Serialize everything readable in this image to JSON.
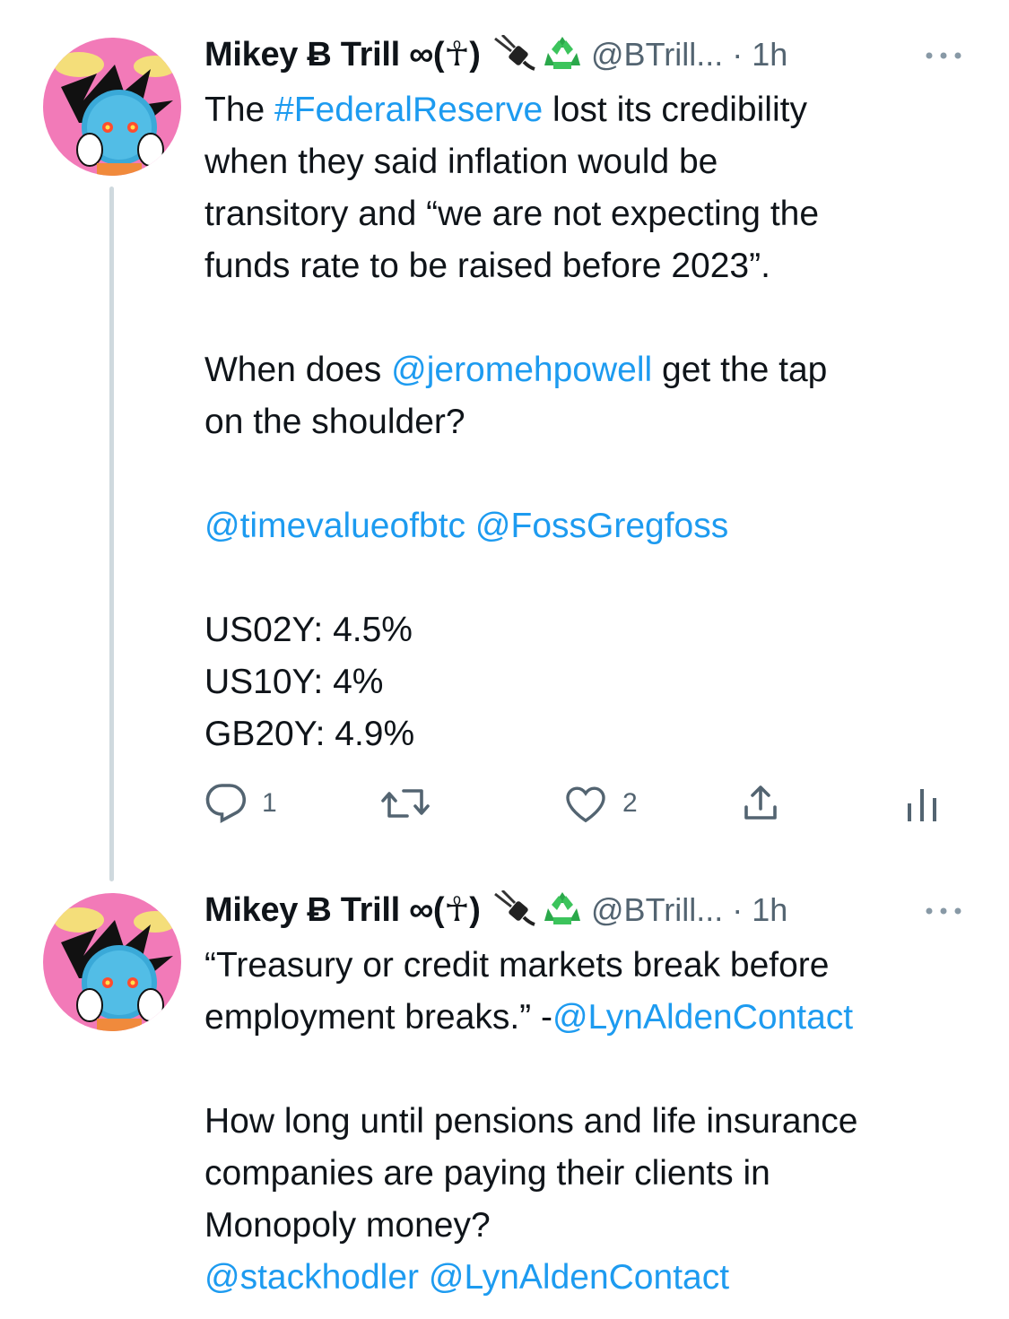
{
  "tweets": [
    {
      "author_name": "Mikey Ƀ Trill ∞(☥)",
      "handle_time": "@BTrill... · 1h",
      "lines": [
        [
          {
            "t": "The "
          },
          {
            "t": "#FederalReserve",
            "link": true
          },
          {
            "t": " lost its credibility"
          }
        ],
        [
          {
            "t": "when they said inflation would be"
          }
        ],
        [
          {
            "t": "transitory and “we are not expecting the"
          }
        ],
        [
          {
            "t": "funds rate to be raised before 2023”."
          }
        ],
        [],
        [
          {
            "t": "When does "
          },
          {
            "t": "@jeromehpowell",
            "link": true
          },
          {
            "t": " get the tap"
          }
        ],
        [
          {
            "t": "on the shoulder?"
          }
        ],
        [],
        [
          {
            "t": "@timevalueofbtc",
            "link": true
          },
          {
            "t": " "
          },
          {
            "t": "@FossGregfoss",
            "link": true
          }
        ],
        [],
        [
          {
            "t": "US02Y: 4.5%"
          }
        ],
        [
          {
            "t": "US10Y: 4%"
          }
        ],
        [
          {
            "t": "GB20Y: 4.9%"
          }
        ]
      ],
      "actions": {
        "reply_count": "1",
        "retweet_count": "",
        "like_count": "2"
      }
    },
    {
      "author_name": "Mikey Ƀ Trill ∞(☥)",
      "handle_time": "@BTrill... · 1h",
      "lines": [
        [
          {
            "t": "“Treasury or credit markets break before"
          }
        ],
        [
          {
            "t": "employment breaks.” -"
          },
          {
            "t": "@LynAldenContact",
            "link": true
          }
        ],
        [],
        [
          {
            "t": "How long until pensions and life insurance"
          }
        ],
        [
          {
            "t": "companies are paying their clients in"
          }
        ],
        [
          {
            "t": "Monopoly money?"
          }
        ],
        [
          {
            "t": "@stackhodler",
            "link": true
          },
          {
            "t": " "
          },
          {
            "t": "@LynAldenContact",
            "link": true
          }
        ]
      ]
    }
  ],
  "colors": {
    "link": "#1d9bf0",
    "muted": "#536471",
    "thread_line": "#cfd9de"
  },
  "icons": [
    "plug-icon",
    "recycle-icon",
    "more-icon",
    "reply-icon",
    "retweet-icon",
    "like-icon",
    "share-icon",
    "analytics-icon"
  ]
}
